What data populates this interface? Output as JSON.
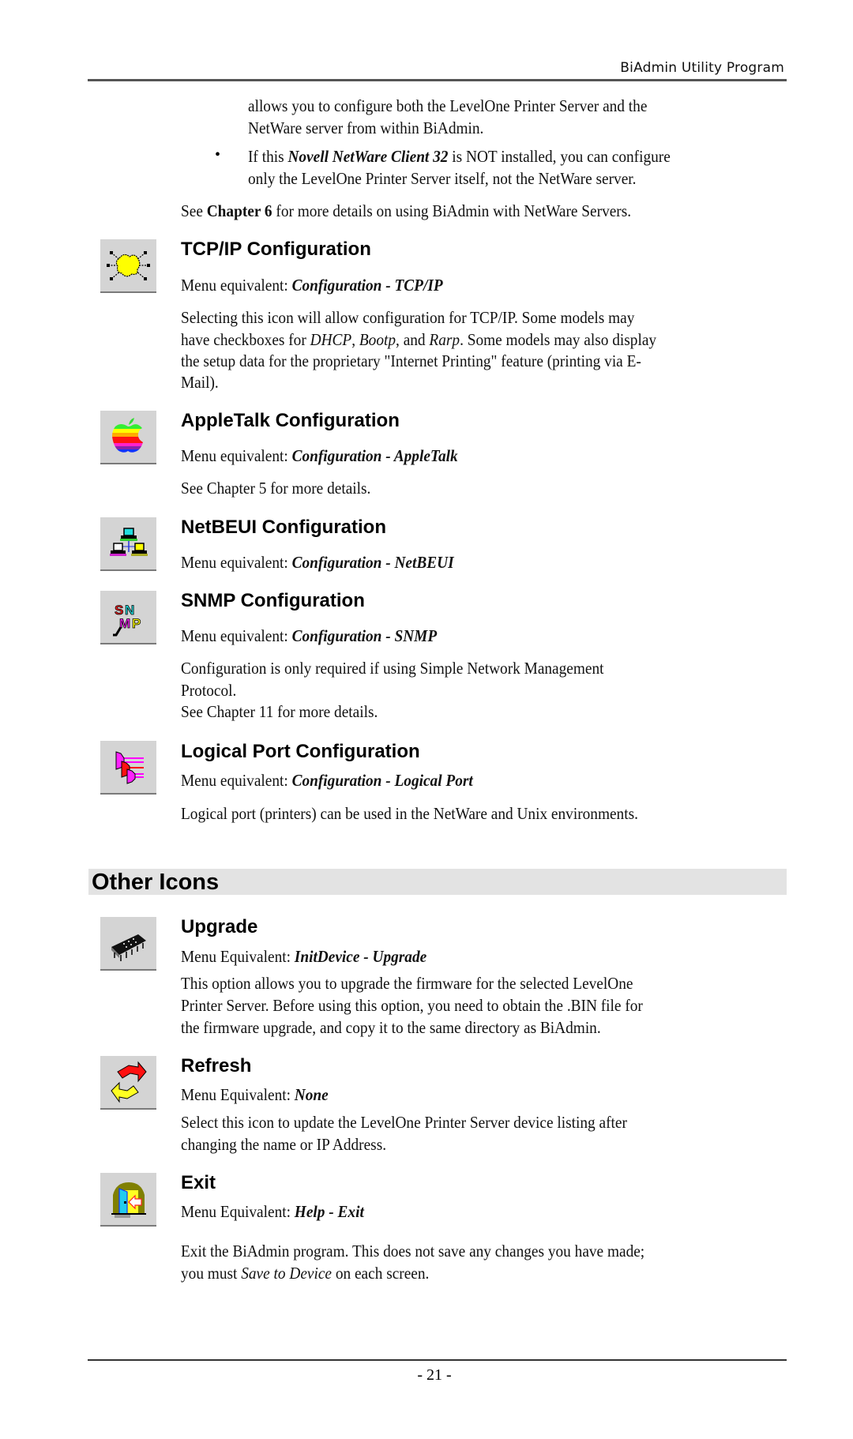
{
  "header": {
    "running_title": "BiAdmin Utility Program"
  },
  "intro": {
    "line1": "allows you to configure both the LevelOne Printer Server and the",
    "line2": "NetWare server from within BiAdmin.",
    "bullet": {
      "prefix": "If this ",
      "emph": "Novell NetWare Client 32",
      "suffix": " is NOT installed, you can configure",
      "line2": "only the LevelOne Printer Server itself, not the NetWare server."
    },
    "see": {
      "prefix": "See ",
      "bold": "Chapter 6",
      "suffix": " for more details on using BiAdmin with NetWare Servers."
    }
  },
  "sections": {
    "tcpip": {
      "icon": "tcpip-network-icon",
      "title": "TCP/IP Configuration",
      "menu_label": "Menu equivalent: ",
      "menu_value": "Configuration - TCP/IP",
      "body": {
        "l1": "Selecting this icon will allow configuration for TCP/IP. Some models may",
        "l2_a": "have checkboxes for ",
        "l2_dhcp": "DHCP",
        "l2_b": ", ",
        "l2_bootp": "Bootp",
        "l2_c": ", and ",
        "l2_rarp": "Rarp",
        "l2_d": ". Some models may also display",
        "l3": "the setup data for the proprietary \"Internet Printing\" feature (printing via E-",
        "l4": "Mail)."
      }
    },
    "appletalk": {
      "icon": "apple-rainbow-icon",
      "title": "AppleTalk Configuration",
      "menu_label": "Menu equivalent: ",
      "menu_value": "Configuration - AppleTalk",
      "body": "See Chapter 5 for more details."
    },
    "netbeui": {
      "icon": "netbeui-computers-icon",
      "title": "NetBEUI Configuration",
      "menu_label": "Menu equivalent: ",
      "menu_value": "Configuration - NetBEUI"
    },
    "snmp": {
      "icon": "snmp-icon",
      "title": "SNMP Configuration",
      "menu_label": "Menu equivalent: ",
      "menu_value": "Configuration - SNMP",
      "body": {
        "l1": "Configuration is only required if using Simple Network Management",
        "l2": "Protocol.",
        "l3": "See Chapter 11 for more details."
      }
    },
    "logical_port": {
      "icon": "logical-port-icon",
      "title": "Logical Port Configuration",
      "menu_label": "Menu equivalent: ",
      "menu_value": "Configuration - Logical Port",
      "body": "Logical port (printers) can be used in the NetWare and Unix environments."
    }
  },
  "other_icons": {
    "title": "Other Icons",
    "upgrade": {
      "icon": "chip-upgrade-icon",
      "title": "Upgrade",
      "menu_label": "Menu Equivalent: ",
      "menu_value": "InitDevice - Upgrade",
      "body": {
        "l1": "This option allows you to upgrade the firmware for the selected LevelOne",
        "l2": "Printer Server. Before using this option, you need to obtain the .BIN file for",
        "l3": "the firmware upgrade, and copy it to the same directory as BiAdmin."
      }
    },
    "refresh": {
      "icon": "refresh-arrows-icon",
      "title": "Refresh",
      "menu_label": "Menu Equivalent: ",
      "menu_value": "None",
      "body": {
        "l1": "Select this icon to update the LevelOne Printer Server device listing after",
        "l2": "changing the name or IP Address."
      }
    },
    "exit": {
      "icon": "exit-door-icon",
      "title": "Exit",
      "menu_label": "Menu Equivalent: ",
      "menu_value": "Help - Exit",
      "body": {
        "l1": "Exit the BiAdmin program. This does not save any changes you have made;",
        "l2_a": "you must ",
        "l2_em": "Save to Device",
        "l2_b": " on each screen."
      }
    }
  },
  "footer": {
    "page_number": "- 21 -"
  }
}
